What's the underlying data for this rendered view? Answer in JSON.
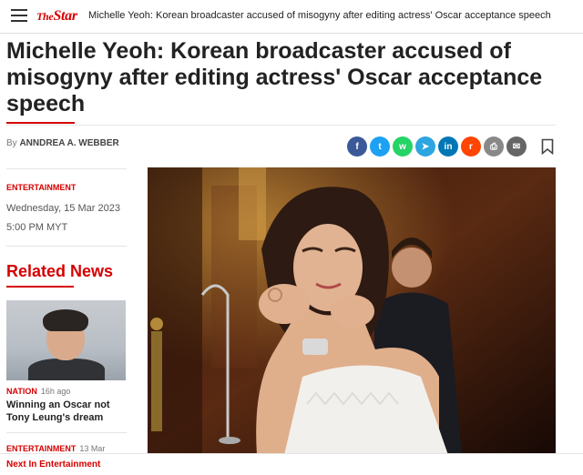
{
  "site": {
    "logo_the": "The",
    "logo_star": "Star",
    "top_title": "Michelle Yeoh: Korean broadcaster accused of misogyny after editing actress' Oscar acceptance speech"
  },
  "article": {
    "headline": "Michelle Yeoh: Korean broadcaster accused of misogyny after editing actress' Oscar acceptance speech",
    "byline_prefix": "By",
    "author": "ANNDREA A. WEBBER",
    "category": "ENTERTAINMENT",
    "date": "Wednesday, 15 Mar 2023",
    "time": "5:00 PM MYT"
  },
  "share": {
    "icons": [
      {
        "name": "facebook-icon",
        "glyph": "f",
        "color": "#3b5998"
      },
      {
        "name": "twitter-icon",
        "glyph": "t",
        "color": "#1da1f2"
      },
      {
        "name": "whatsapp-icon",
        "glyph": "w",
        "color": "#25d366"
      },
      {
        "name": "telegram-icon",
        "glyph": "➤",
        "color": "#2ca5e0"
      },
      {
        "name": "linkedin-icon",
        "glyph": "in",
        "color": "#0077b5"
      },
      {
        "name": "reddit-icon",
        "glyph": "r",
        "color": "#ff4500"
      },
      {
        "name": "print-icon",
        "glyph": "⎙",
        "color": "#888888"
      },
      {
        "name": "email-icon",
        "glyph": "✉",
        "color": "#666666"
      }
    ]
  },
  "related": {
    "heading": "Related News",
    "items": [
      {
        "category": "NATION",
        "ago": "16h ago",
        "title": "Winning an Oscar not Tony Leung's dream"
      },
      {
        "category": "ENTERTAINMENT",
        "ago": "13 Mar"
      }
    ]
  },
  "footer": {
    "next_label": "Next In Entertainment"
  },
  "colors": {
    "brand_red": "#d50000"
  }
}
